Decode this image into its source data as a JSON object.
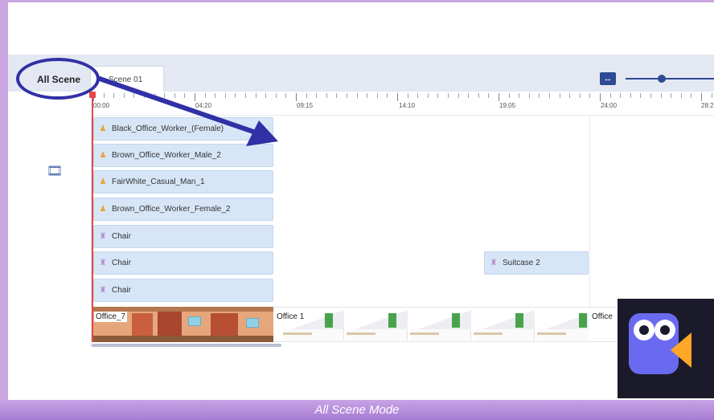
{
  "tabs": {
    "all_scene": "All Scene",
    "scene_01": "Scene 01"
  },
  "ruler": {
    "ticks": [
      "00:00",
      "04:20",
      "09:15",
      "14:10",
      "19:05",
      "24:00",
      "28:2"
    ]
  },
  "tracks": [
    {
      "kind": "person",
      "label": "Black_Office_Worker_(Female)"
    },
    {
      "kind": "person",
      "label": "Brown_Office_Worker_Male_2"
    },
    {
      "kind": "person",
      "label": "FairWhite_Casual_Man_1"
    },
    {
      "kind": "person",
      "label": "Brown_Office_Worker_Female_2"
    },
    {
      "kind": "prop",
      "label": "Chair"
    },
    {
      "kind": "prop",
      "label": "Chair"
    },
    {
      "kind": "prop",
      "label": "Chair"
    }
  ],
  "extra_clip": {
    "kind": "prop",
    "label": "Suitcase 2"
  },
  "scenes": [
    {
      "label": "Office_7"
    },
    {
      "label": "Office 1"
    },
    {
      "label": "Office"
    }
  ],
  "caption": "All Scene Mode",
  "colors": {
    "accent": "#2f4a94",
    "callout": "#3130a6",
    "playhead": "#e54848",
    "track_fill": "#d7e6f7",
    "caption_bar": "#b690dc"
  },
  "icons": {
    "fit_button": "expand-horizontal-icon",
    "film": "film-strip-icon",
    "person": "person-icon",
    "prop": "prop-icon",
    "logo": "camera-mascot-logo"
  }
}
